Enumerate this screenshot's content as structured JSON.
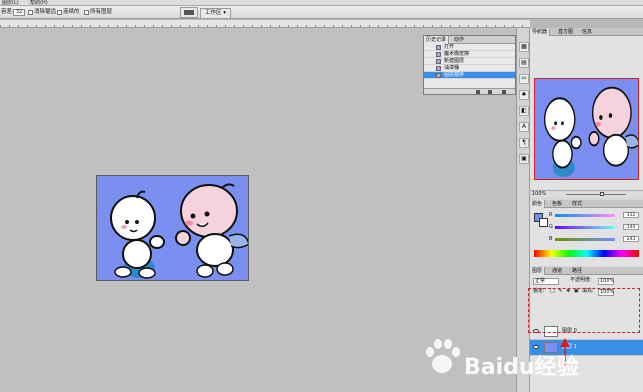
{
  "menubar": {
    "items": [
      "图层(L)",
      "帮助(H)"
    ]
  },
  "options": {
    "tolerance_label": "容差:",
    "tolerance_value": "32",
    "antialias_label": "消除锯齿",
    "contiguous_label": "连续的",
    "all_layers_label": "所有图层",
    "workspace_label": "工作区 ▾"
  },
  "history": {
    "tabs": [
      "历史记录",
      "动作"
    ],
    "items": [
      "打开",
      "魔术橡皮擦",
      "新建图层",
      "油漆桶",
      "图层顺序"
    ],
    "selected_index": 4
  },
  "navigator": {
    "tabs": [
      "导航器",
      "直方图",
      "信息"
    ],
    "zoom": "100%"
  },
  "color": {
    "tabs": [
      "颜色",
      "色板",
      "样式"
    ],
    "r_label": "R",
    "r_value": "112",
    "g_label": "G",
    "g_value": "144",
    "b_label": "B",
    "b_value": "243",
    "fg_color": "#7090f3"
  },
  "layers": {
    "tabs": [
      "图层",
      "通道",
      "路径"
    ],
    "blend_mode": "正常",
    "opacity_label": "不透明度:",
    "opacity_value": "100%",
    "lock_label": "锁定:",
    "fill_label": "填充:",
    "fill_value": "100%",
    "items": [
      {
        "name": "图层 0",
        "selected": false
      },
      {
        "name": "图层 1",
        "selected": true
      }
    ]
  },
  "watermark": {
    "text": "Baidu经验"
  },
  "colors": {
    "canvas_blue": "#7b8ff0",
    "selection": "#3a8ee6",
    "annotation_red": "#cc2222"
  }
}
